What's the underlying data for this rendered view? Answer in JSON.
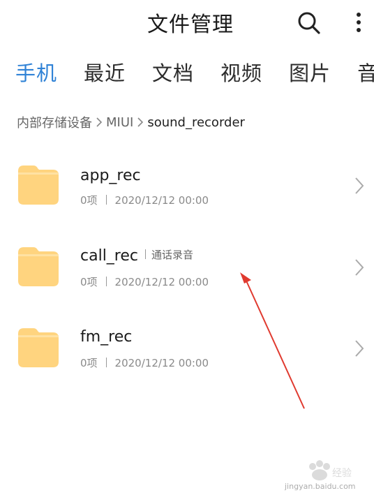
{
  "header": {
    "title": "文件管理"
  },
  "tabs": [
    {
      "label": "手机",
      "active": true
    },
    {
      "label": "最近",
      "active": false
    },
    {
      "label": "文档",
      "active": false
    },
    {
      "label": "视频",
      "active": false
    },
    {
      "label": "图片",
      "active": false
    },
    {
      "label": "音",
      "active": false
    }
  ],
  "breadcrumb": [
    "内部存储设备",
    "MIUI",
    "sound_recorder"
  ],
  "folders": [
    {
      "name": "app_rec",
      "tag": "",
      "count": "0项",
      "date": "2020/12/12 00:00"
    },
    {
      "name": "call_rec",
      "tag": "通话录音",
      "count": "0项",
      "date": "2020/12/12 00:00"
    },
    {
      "name": "fm_rec",
      "tag": "",
      "count": "0项",
      "date": "2020/12/12 00:00"
    }
  ],
  "icons": {
    "search": "search-icon",
    "more": "more-vertical-icon",
    "folder": "folder-icon",
    "chevron": "chevron-right-icon"
  },
  "colors": {
    "accent": "#2f82d6",
    "folder": "#ffd47f",
    "annotation": "#e03a2f"
  },
  "watermark": {
    "text": "jingyan.baidu.com"
  }
}
